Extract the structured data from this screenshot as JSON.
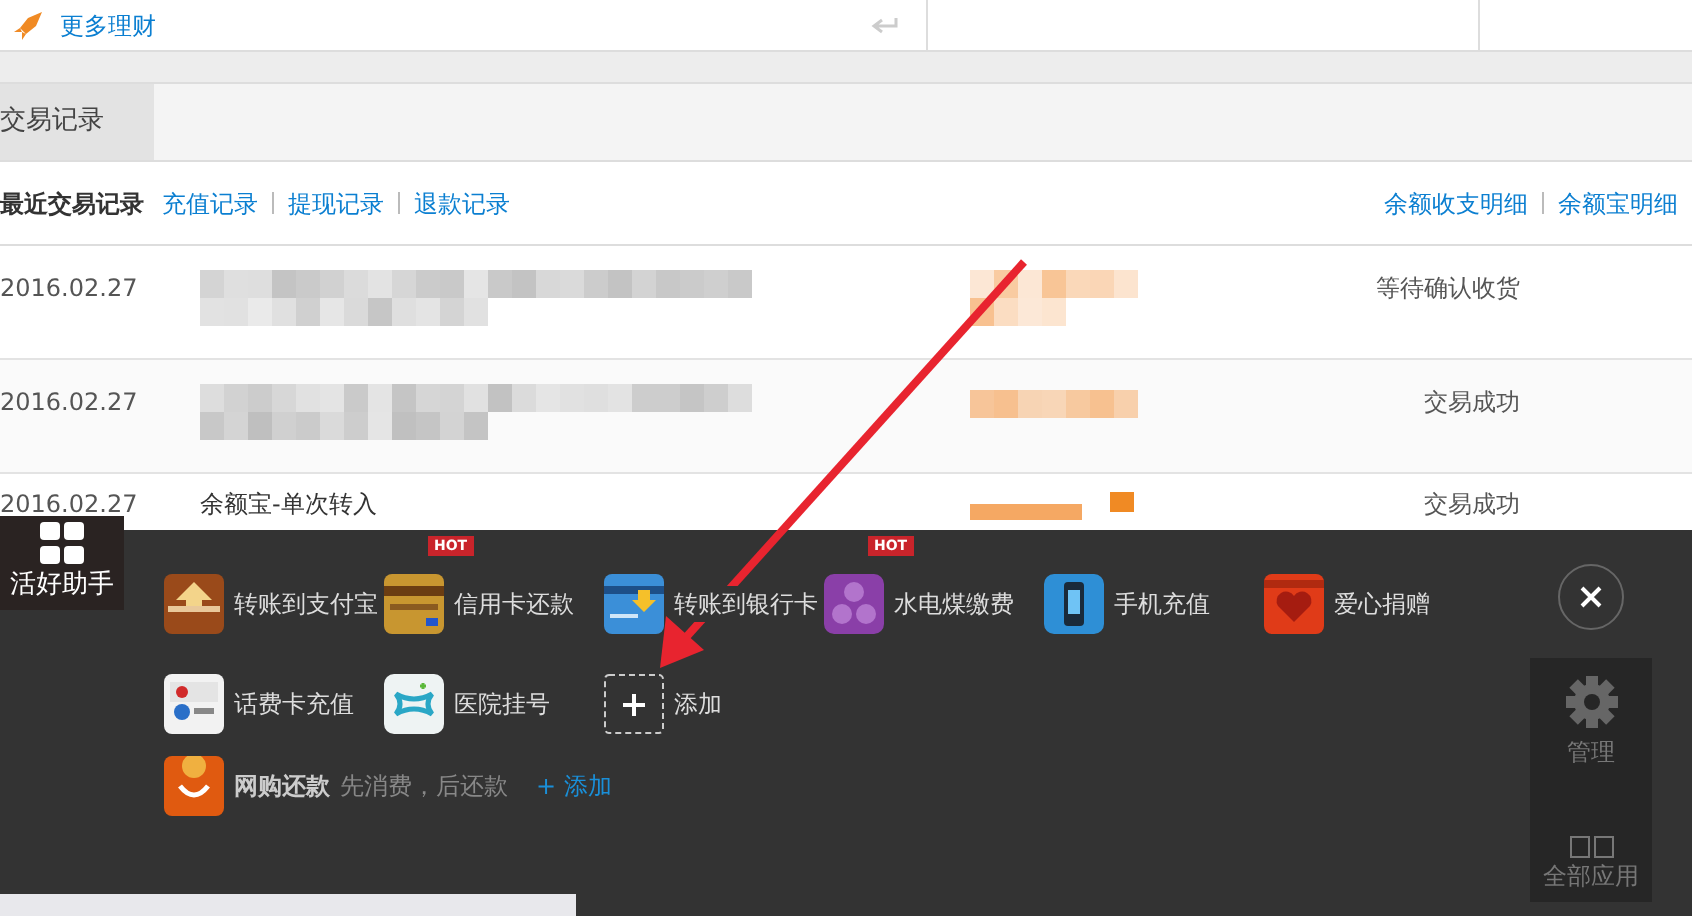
{
  "top_row": {
    "link": "更多理财"
  },
  "tabs": [
    {
      "label": "交易记录",
      "selected": true
    }
  ],
  "record_links": {
    "title": "最近交易记录",
    "links": [
      "充值记录",
      "提现记录",
      "退款记录"
    ],
    "right_links": [
      "余额收支明细",
      "余额宝明细"
    ]
  },
  "transactions": [
    {
      "date": "2016.02.27",
      "redacted": true,
      "status": "等待确认收货"
    },
    {
      "date": "2016.02.27",
      "redacted": true,
      "status": "交易成功"
    },
    {
      "date": "2016.02.27",
      "redacted": false,
      "name": "余额宝-单次转入",
      "status": "交易成功"
    }
  ],
  "assistant": {
    "title": "活好助手",
    "apps": [
      {
        "label": "转账到支付宝",
        "kind": "transfer"
      },
      {
        "label": "信用卡还款",
        "kind": "card",
        "badge": "HOT"
      },
      {
        "label": "转账到银行卡",
        "kind": "bank"
      },
      {
        "label": "水电煤缴费",
        "kind": "utility",
        "badge": "HOT"
      },
      {
        "label": "手机充值",
        "kind": "phone"
      },
      {
        "label": "爱心捐赠",
        "kind": "charity"
      },
      {
        "label": "话费卡充值",
        "kind": "telecom"
      },
      {
        "label": "医院挂号",
        "kind": "hospital"
      },
      {
        "label": "添加",
        "kind": "add"
      }
    ],
    "promo": {
      "label": "网购还款",
      "note": "先消费，后还款",
      "action": "+ 添加"
    },
    "side": {
      "manage": "管理",
      "all_apps": "全部应用"
    }
  }
}
